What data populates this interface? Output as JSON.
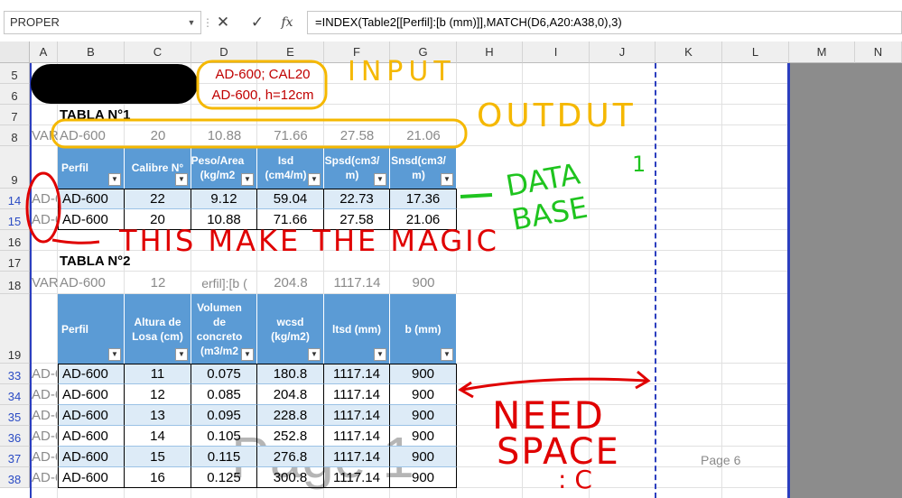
{
  "formula_bar": {
    "name_box": "PROPER",
    "cancel_icon": "✕",
    "enter_icon": "✓",
    "fx_label": "fx",
    "formula": "=INDEX(Table2[[Perfil]:[b (mm)]],MATCH(D6,A20:A38,0),3)"
  },
  "columns": [
    "A",
    "B",
    "C",
    "D",
    "E",
    "F",
    "G",
    "H",
    "I",
    "J",
    "K",
    "L",
    "M",
    "N"
  ],
  "rows": [
    "5",
    "6",
    "7",
    "8",
    "9",
    "14",
    "15",
    "16",
    "17",
    "18",
    "19",
    "33",
    "34",
    "35",
    "36",
    "37",
    "38"
  ],
  "input": {
    "line1": "AD-600; CAL20",
    "line2": "AD-600, h=12cm"
  },
  "tabla1": {
    "title": "TABLA N°1",
    "output_row": [
      "VAR",
      "AD-600",
      "20",
      "10.88",
      "71.66",
      "27.58",
      "21.06"
    ],
    "headers": [
      "Perfil",
      "Calibre N°",
      "Peso/Area (kg/m2",
      "Isd (cm4/m)",
      "Spsd(cm3/ m)",
      "Snsd(cm3/ m)"
    ],
    "rows": [
      {
        "a": "AD-6",
        "cells": [
          "AD-600",
          "22",
          "9.12",
          "59.04",
          "22.73",
          "17.36"
        ]
      },
      {
        "a": "AD-6",
        "cells": [
          "AD-600",
          "20",
          "10.88",
          "71.66",
          "27.58",
          "21.06"
        ]
      }
    ]
  },
  "tabla2": {
    "title": "TABLA N°2",
    "output_row": [
      "VAR",
      "AD-600",
      "12",
      "erfil]:[b (",
      "204.8",
      "1117.14",
      "900"
    ],
    "headers": [
      "Perfil",
      "Altura de Losa (cm)",
      "Volumen de concreto (m3/m2",
      "wcsd (kg/m2)",
      "ltsd (mm)",
      "b (mm)"
    ],
    "rows": [
      {
        "a": "AD-6",
        "cells": [
          "AD-600",
          "11",
          "0.075",
          "180.8",
          "1117.14",
          "900"
        ]
      },
      {
        "a": "AD-6",
        "cells": [
          "AD-600",
          "12",
          "0.085",
          "204.8",
          "1117.14",
          "900"
        ]
      },
      {
        "a": "AD-6",
        "cells": [
          "AD-600",
          "13",
          "0.095",
          "228.8",
          "1117.14",
          "900"
        ]
      },
      {
        "a": "AD-6",
        "cells": [
          "AD-600",
          "14",
          "0.105",
          "252.8",
          "1117.14",
          "900"
        ]
      },
      {
        "a": "AD-6",
        "cells": [
          "AD-600",
          "15",
          "0.115",
          "276.8",
          "1117.14",
          "900"
        ]
      },
      {
        "a": "AD-6",
        "cells": [
          "AD-600",
          "16",
          "0.125",
          "300.8",
          "1117.14",
          "900"
        ]
      }
    ]
  },
  "annotations": {
    "input": "INPUT",
    "output": "OUTDUT",
    "database": "DATA BASE",
    "database_num": "1",
    "magic": "THIS MAKE THE MAGIC",
    "need": "NEED",
    "space": "SPACE",
    "sad": ": C"
  },
  "watermarks": {
    "page1": "Page 1",
    "page6": "Page 6"
  },
  "colors": {
    "accent_blue": "#5b9bd5",
    "band": "#ddebf7",
    "annotation_yellow": "#f5b800",
    "annotation_red": "#e00000",
    "annotation_green": "#1fc41f",
    "page_break": "#2c3fbf"
  }
}
